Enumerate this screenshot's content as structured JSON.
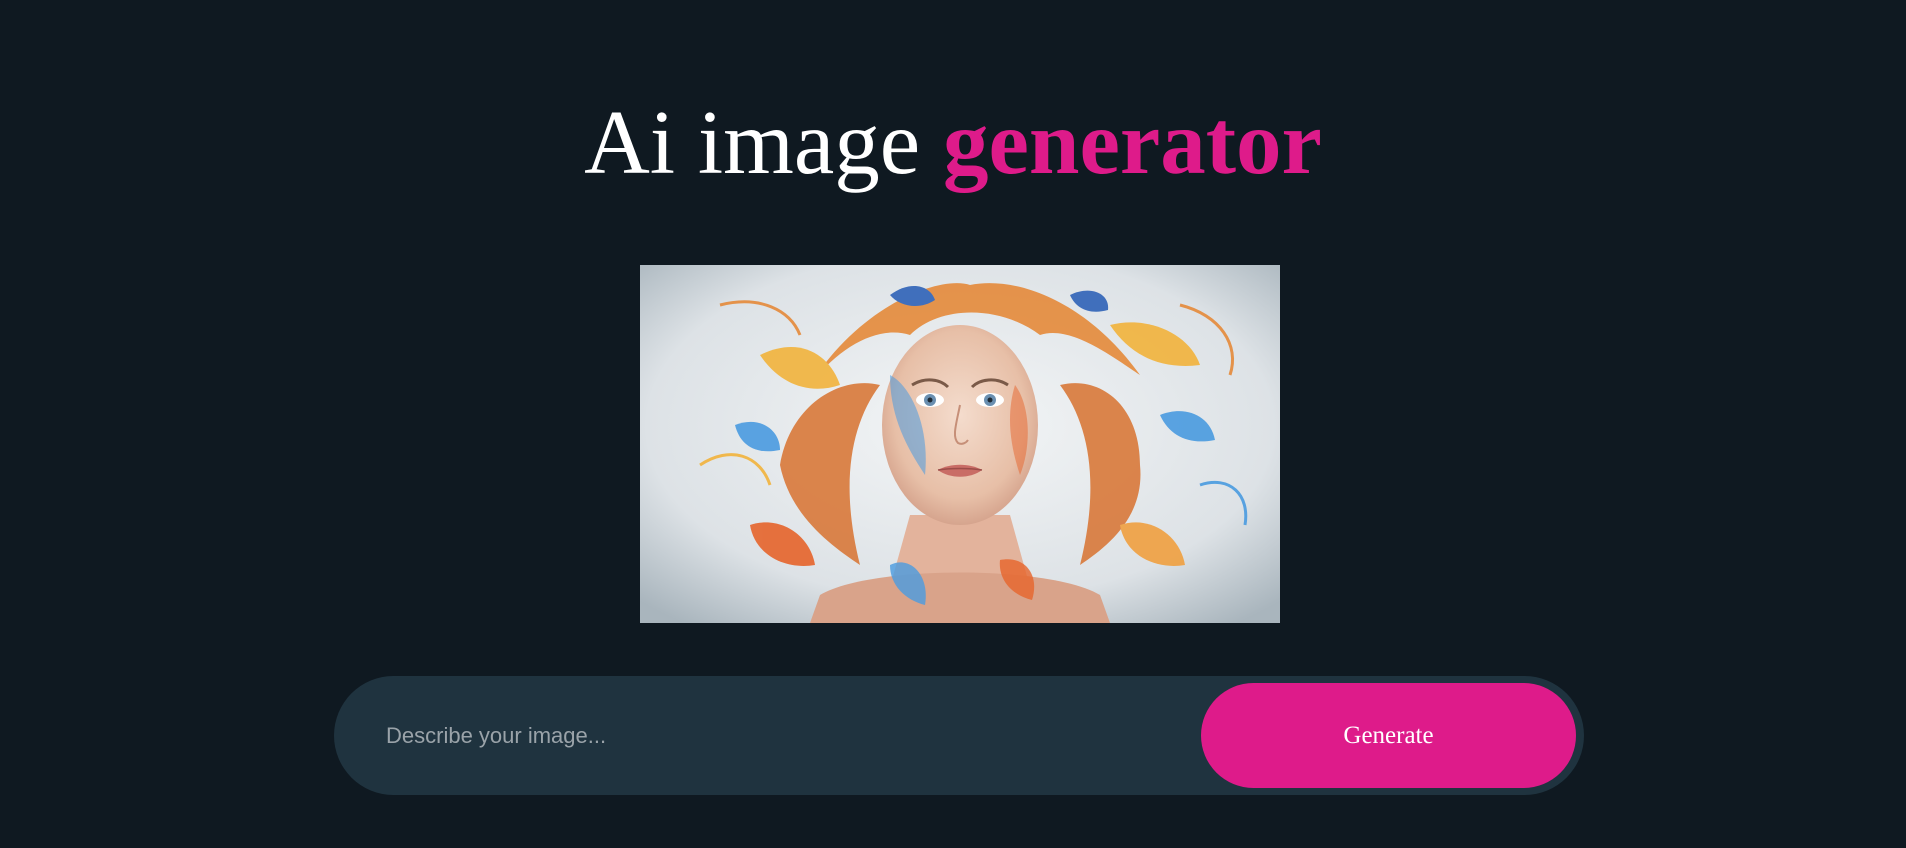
{
  "header": {
    "title_part1": "Ai image",
    "title_accent": "generator"
  },
  "preview": {
    "image_label": "portrait-painting"
  },
  "prompt": {
    "placeholder": "Describe your image...",
    "value": "",
    "button_label": "Generate"
  },
  "colors": {
    "background": "#0f1921",
    "accent": "#de1b8a",
    "input_bg": "#1f333f"
  }
}
